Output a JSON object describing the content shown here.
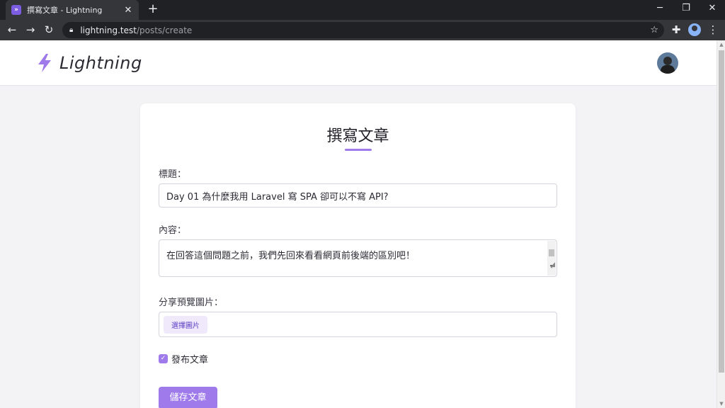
{
  "browser": {
    "tab_title": "撰寫文章 - Lightning",
    "tab_close": "✕",
    "new_tab": "+",
    "url_host": "lightning.test",
    "url_path": "/posts/create",
    "window_controls": {
      "minimize": "─",
      "restore": "❐",
      "close": "✕"
    }
  },
  "site": {
    "brand": "Lightning",
    "accent_color": "#9f7aea"
  },
  "form": {
    "title": "撰寫文章",
    "title_label": "標題：",
    "title_value": "Day 01 為什麼我用 Laravel 寫 SPA 卻可以不寫 API?",
    "content_label": "內容：",
    "content_value": "在回答這個問題之前，我們先回來看看網頁前後端的區別吧！",
    "image_label": "分享預覽圖片：",
    "choose_image": "選擇圖片",
    "publish_label": "發布文章",
    "publish_checked": true,
    "save_button": "儲存文章"
  }
}
